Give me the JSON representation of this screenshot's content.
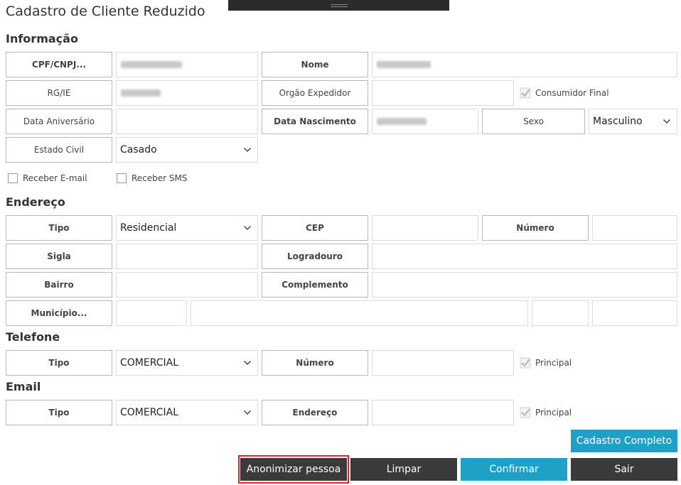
{
  "title": "Cadastro de Cliente Reduzido",
  "sections": {
    "info": "Informação",
    "endereco": "Endereço",
    "telefone": "Telefone",
    "email": "Email"
  },
  "info": {
    "cpf_label": "CPF/CNPJ...",
    "nome_label": "Nome",
    "rg_label": "RG/IE",
    "orgao_label": "Orgão Expedidor",
    "consumidor_final": "Consumidor Final",
    "aniversario_label": "Data Aniversário",
    "nascimento_label": "Data Nascimento",
    "sexo_label": "Sexo",
    "sexo_value": "Masculino",
    "estado_civil_label": "Estado Civil",
    "estado_civil_value": "Casado",
    "receber_email": "Receber E-mail",
    "receber_sms": "Receber SMS"
  },
  "endereco": {
    "tipo_label": "Tipo",
    "tipo_value": "Residencial",
    "cep_label": "CEP",
    "numero_label": "Número",
    "sigla_label": "Sigla",
    "logradouro_label": "Logradouro",
    "bairro_label": "Bairro",
    "complemento_label": "Complemento",
    "municipio_label": "Município..."
  },
  "telefone": {
    "tipo_label": "Tipo",
    "tipo_value": "COMERCIAL",
    "numero_label": "Número",
    "principal": "Principal"
  },
  "email": {
    "tipo_label": "Tipo",
    "tipo_value": "COMERCIAL",
    "endereco_label": "Endereço",
    "principal": "Principal"
  },
  "buttons": {
    "cadastro_completo": "Cadastro Completo",
    "anonimizar": "Anonimizar pessoa",
    "limpar": "Limpar",
    "confirmar": "Confirmar",
    "sair": "Sair"
  },
  "colors": {
    "blue_button": "#1ea0c7",
    "dark_button": "#3a3a3a",
    "highlight": "#d9252a"
  }
}
